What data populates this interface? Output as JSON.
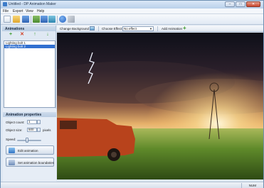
{
  "window": {
    "title": "Untitled - DP Animation Maker",
    "controls": {
      "minimize": "–",
      "maximize": "□",
      "close": "✕"
    }
  },
  "menu": [
    "File",
    "Export",
    "View",
    "Help"
  ],
  "toolbar": {
    "icons": [
      "new-file-icon",
      "open-folder-icon",
      "save-icon",
      "save-as-icon",
      "export-icon",
      "export-html-icon",
      "refresh-icon",
      "info-icon",
      "key-icon"
    ]
  },
  "animations": {
    "header": "Animations",
    "buttons": {
      "add": "+",
      "remove": "✕",
      "move_up": "↑",
      "move_down": "↓"
    },
    "items": [
      {
        "label": "Lighting bolt 1",
        "selected": false
      },
      {
        "label": "Lighting bolt 2",
        "selected": true
      }
    ]
  },
  "properties": {
    "header": "Animation properties",
    "object_count": {
      "label": "Object count:",
      "value": "1"
    },
    "object_size": {
      "label": "Object size:",
      "value": "500",
      "unit": "pixels"
    },
    "speed": {
      "label": "Speed:",
      "value": 0.5
    },
    "edit_button": "Edit animation",
    "boundaries_button": "Set animation boundaries"
  },
  "editor": {
    "change_background": "Change Background",
    "choose_effect_label": "Choose Effect:",
    "effect_value": "No effect",
    "add_animation": "Add Animation"
  },
  "statusbar": {
    "mode": "NUM"
  },
  "colors": {
    "accent": "#3170d0",
    "window_border": "#6d8fb3",
    "panel_bg": "#dfe8f3"
  }
}
